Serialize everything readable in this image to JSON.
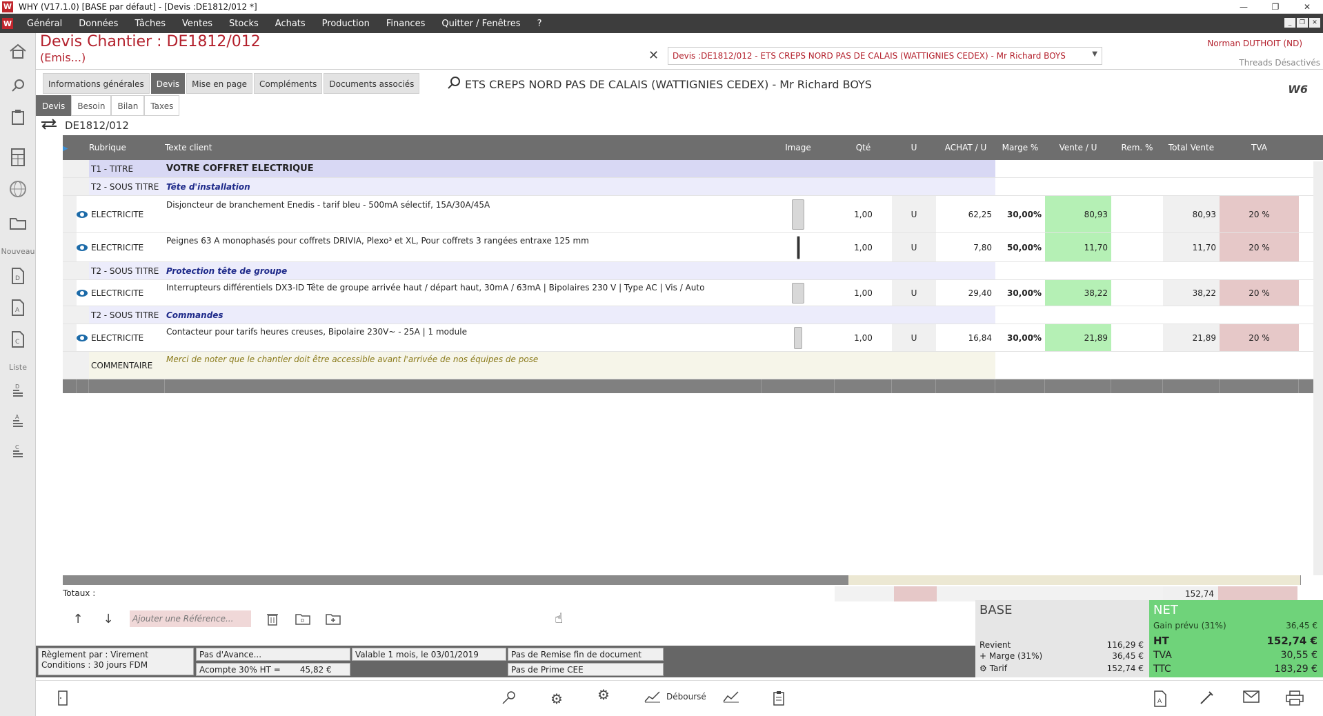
{
  "window": {
    "title": "WHY (V17.1.0)  [BASE par défaut] - [Devis :DE1812/012 *]",
    "logo_letter": "W",
    "controls": [
      "—",
      "❐",
      "✕"
    ]
  },
  "menu": {
    "items": [
      "Général",
      "Données",
      "Tâches",
      "Ventes",
      "Stocks",
      "Achats",
      "Production",
      "Finances",
      "Quitter / Fenêtres",
      "?"
    ],
    "mdi_controls": [
      "_",
      "❐",
      "✕"
    ]
  },
  "sidebar": {
    "nouveau_label": "Nouveau",
    "liste_label": "Liste"
  },
  "header": {
    "doc_title": "Devis  Chantier : DE1812/012",
    "doc_status": "(Emis...)",
    "doc_select": "Devis :DE1812/012 - ETS CREPS NORD PAS DE CALAIS  (WATTIGNIES CEDEX) - Mr Richard BOYS",
    "user": "Norman DUTHOIT (ND)",
    "threads": "Threads Désactivés",
    "client_line": "ETS CREPS NORD PAS DE CALAIS  (WATTIGNIES CEDEX) - Mr Richard BOYS",
    "logo_right": "W6"
  },
  "tabs_main": [
    "Informations générales",
    "Devis",
    "Mise en page",
    "Compléments",
    "Documents associés"
  ],
  "tabs_main_active": "Devis",
  "tabs_sub": [
    "Devis",
    "Besoin",
    "Bilan",
    "Taxes"
  ],
  "tabs_sub_active": "Devis",
  "reference": "DE1812/012",
  "grid": {
    "headers": {
      "rubrique": "Rubrique",
      "texte": "Texte client",
      "image": "Image",
      "qte": "Qté",
      "u": "U",
      "achat": "ACHAT / U",
      "marge": "Marge %",
      "vente": "Vente / U",
      "rem": "Rem. %",
      "total": "Total Vente",
      "tva": "TVA"
    },
    "rows": [
      {
        "type": "title",
        "rubrique": "T1 - TITRE",
        "texte": "VOTRE COFFRET ELECTRIQUE"
      },
      {
        "type": "sub",
        "rubrique": "T2 - SOUS TITRE",
        "texte": "Tête d'installation"
      },
      {
        "type": "item",
        "rubrique": "ELECTRICITE",
        "texte": "Disjoncteur de branchement Enedis - tarif bleu - 500mA sélectif, 15A/30A/45A",
        "qte": "1,00",
        "u": "U",
        "achat": "62,25",
        "marge": "30,00%",
        "vente": "80,93",
        "rem": "",
        "total": "80,93",
        "tva": "20 %"
      },
      {
        "type": "item",
        "rubrique": "ELECTRICITE",
        "texte": "Peignes 63 A monophasés pour coffrets DRIVIA, Plexo³ et XL, Pour coffrets 3 rangées entraxe 125 mm",
        "qte": "1,00",
        "u": "U",
        "achat": "7,80",
        "marge": "50,00%",
        "vente": "11,70",
        "rem": "",
        "total": "11,70",
        "tva": "20 %"
      },
      {
        "type": "sub",
        "rubrique": "T2 - SOUS TITRE",
        "texte": "Protection tête de groupe"
      },
      {
        "type": "item",
        "rubrique": "ELECTRICITE",
        "texte": "Interrupteurs différentiels DX3-ID Tête de groupe arrivée haut / départ haut, 30mA / 63mA | Bipolaires 230 V | Type AC | Vis / Auto",
        "qte": "1,00",
        "u": "U",
        "achat": "29,40",
        "marge": "30,00%",
        "vente": "38,22",
        "rem": "",
        "total": "38,22",
        "tva": "20 %"
      },
      {
        "type": "sub",
        "rubrique": "T2 - SOUS TITRE",
        "texte": "Commandes"
      },
      {
        "type": "item",
        "rubrique": "ELECTRICITE",
        "texte": "Contacteur pour tarifs heures creuses, Bipolaire 230V~ - 25A  | 1 module",
        "qte": "1,00",
        "u": "U",
        "achat": "16,84",
        "marge": "30,00%",
        "vente": "21,89",
        "rem": "",
        "total": "21,89",
        "tva": "20 %"
      },
      {
        "type": "comment",
        "rubrique": "COMMENTAIRE",
        "texte": "Merci de noter que le chantier doit être accessible avant l'arrivée de nos équipes de pose"
      }
    ]
  },
  "totaux": {
    "label": "Totaux :",
    "total_vente": "152,74"
  },
  "actions": {
    "ref_placeholder": "Ajouter une Référence..."
  },
  "footer": {
    "reglement": "Règlement par : Virement",
    "conditions": "Conditions : 30 jours FDM",
    "avance": "Pas d'Avance...",
    "acompte_label": "Acompte 30% HT =",
    "acompte_value": "45,82 €",
    "validite": "Valable 1 mois, le 03/01/2019",
    "remise": "Pas de Remise fin de document",
    "prime": "Pas de Prime CEE"
  },
  "base": {
    "title": "BASE",
    "revient_label": "Revient",
    "revient": "116,29 €",
    "marge_label": "+ Marge (31%)",
    "marge": "36,45 €",
    "tarif_label": "Tarif",
    "tarif": "152,74 €"
  },
  "net": {
    "title": "NET",
    "gain_label": "Gain prévu (31%)",
    "gain": "36,45 €",
    "ht_label": "HT",
    "ht": "152,74 €",
    "tva_label": "TVA",
    "tva": "30,55 €",
    "ttc_label": "TTC",
    "ttc": "183,29 €"
  },
  "bottom_bar": {
    "debourse_label": "Déboursé"
  },
  "colors": {
    "accent_red": "#b3202c",
    "menu_bg": "#3d3d3d",
    "grid_header": "#6e6e6e",
    "green_cell": "#b5f0b5",
    "pink_cell": "#e6c8c8",
    "net_green": "#6fd37a"
  }
}
